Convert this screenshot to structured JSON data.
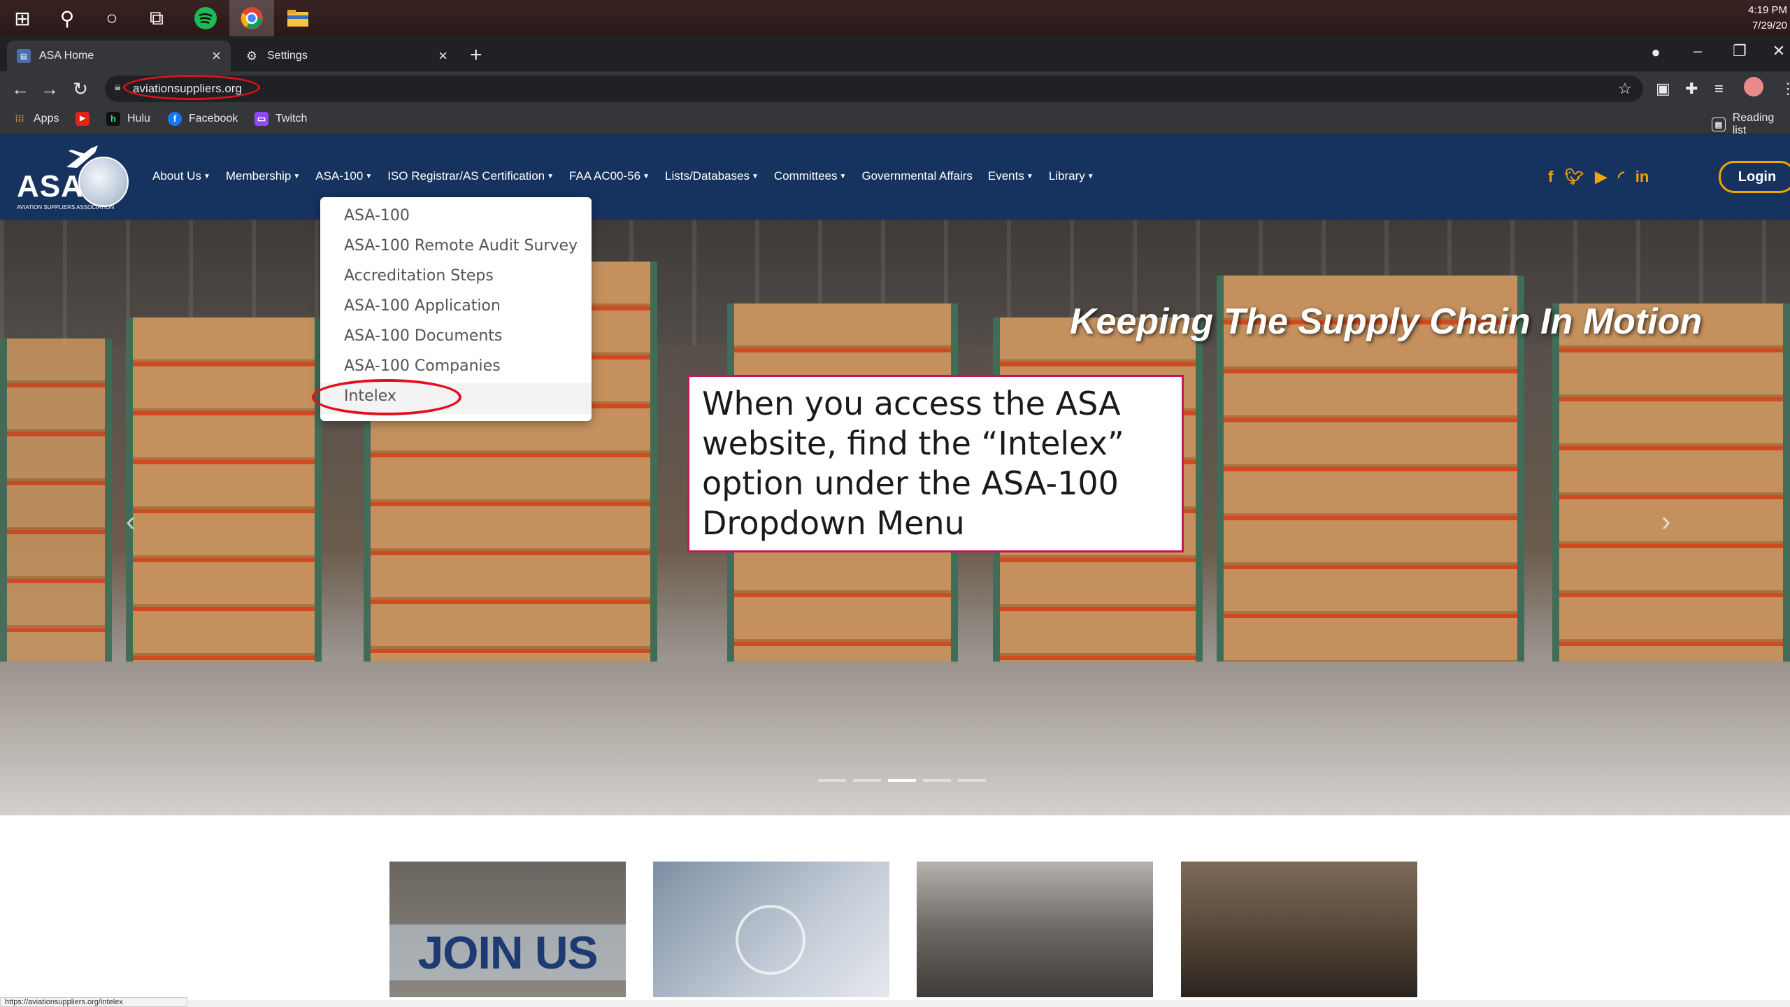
{
  "taskbar": {
    "icons": [
      "windows-icon",
      "search-icon",
      "cortana-icon",
      "task-view-icon",
      "spotify-icon",
      "chrome-icon",
      "file-explorer-icon"
    ],
    "clock_time": "4:19 PM",
    "clock_date": "7/29/20"
  },
  "browser": {
    "tabs": [
      {
        "label": "ASA Home",
        "active": true
      },
      {
        "label": "Settings",
        "active": false
      }
    ],
    "url": "aviationsuppliers.org",
    "bookmarks": [
      {
        "label": "Apps"
      },
      {
        "label": ""
      },
      {
        "label": "Hulu"
      },
      {
        "label": "Facebook"
      },
      {
        "label": "Twitch"
      }
    ],
    "reading_list": "Reading list",
    "status_url": "https://aviationsuppliers.org/intelex"
  },
  "site": {
    "logo_text": "ASA",
    "logo_tagline": "AVIATION SUPPLIERS ASSOCIATION",
    "nav": [
      {
        "label": "About Us",
        "caret": true
      },
      {
        "label": "Membership",
        "caret": true
      },
      {
        "label": "ASA-100",
        "caret": true
      },
      {
        "label": "ISO Registrar/AS Certification",
        "caret": true
      },
      {
        "label": "FAA AC00-56",
        "caret": true
      },
      {
        "label": "Lists/Databases",
        "caret": true
      },
      {
        "label": "Committees",
        "caret": true
      },
      {
        "label": "Governmental Affairs",
        "caret": false
      },
      {
        "label": "Events",
        "caret": true
      },
      {
        "label": "Library",
        "caret": true
      }
    ],
    "social": [
      "facebook-icon",
      "twitter-icon",
      "youtube-icon",
      "rss-icon",
      "linkedin-icon"
    ],
    "login_label": "Login",
    "hero_tagline": "Keeping The Supply Chain In Motion",
    "dropdown_items": [
      "ASA-100",
      "ASA-100 Remote Audit Survey",
      "Accreditation Steps",
      "ASA-100 Application",
      "ASA-100 Documents",
      "ASA-100 Companies",
      "Intelex"
    ],
    "cards": [
      {
        "text": "JOIN US"
      },
      {
        "text": ""
      },
      {
        "text": ""
      },
      {
        "text": ""
      }
    ]
  },
  "callout": {
    "text": "When you access the ASA website, find the “Intelex” option under the ASA-100 Dropdown Menu"
  },
  "colors": {
    "header": "#16325e",
    "accent": "#f0a500",
    "annotation_red": "#e0101c",
    "callout_border": "#c2185b"
  }
}
